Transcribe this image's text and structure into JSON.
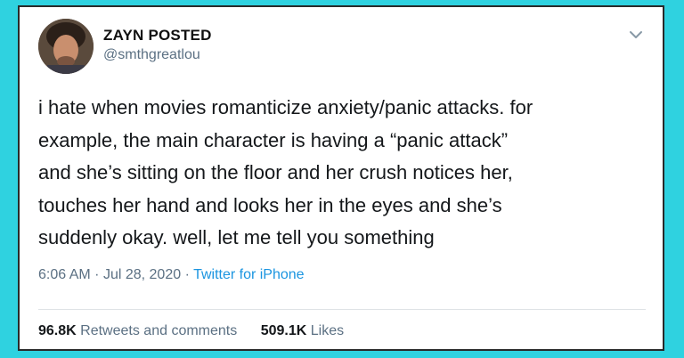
{
  "tweet": {
    "author_name": "ZAYN POSTED",
    "handle": "@smthgreatlou",
    "text_lines": [
      "i hate when movies romanticize anxiety/panic attacks. for",
      "example, the main character is having a “panic attack”",
      "and she’s sitting on the floor and her crush notices her,",
      "touches her hand and looks her in the eyes and she’s",
      "suddenly okay. well, let me tell you something"
    ],
    "time": "6:06 AM",
    "separator": "·",
    "date": "Jul 28, 2020",
    "source": "Twitter for iPhone",
    "retweets_count": "96.8K",
    "retweets_label": "Retweets and comments",
    "likes_count": "509.1K",
    "likes_label": "Likes"
  },
  "icons": {
    "menu": "chevron-down-icon",
    "avatar": "avatar"
  },
  "colors": {
    "background": "#2fd2e0",
    "card": "#ffffff",
    "text": "#14171a",
    "muted": "#5b7083",
    "link": "#1b95e0"
  }
}
